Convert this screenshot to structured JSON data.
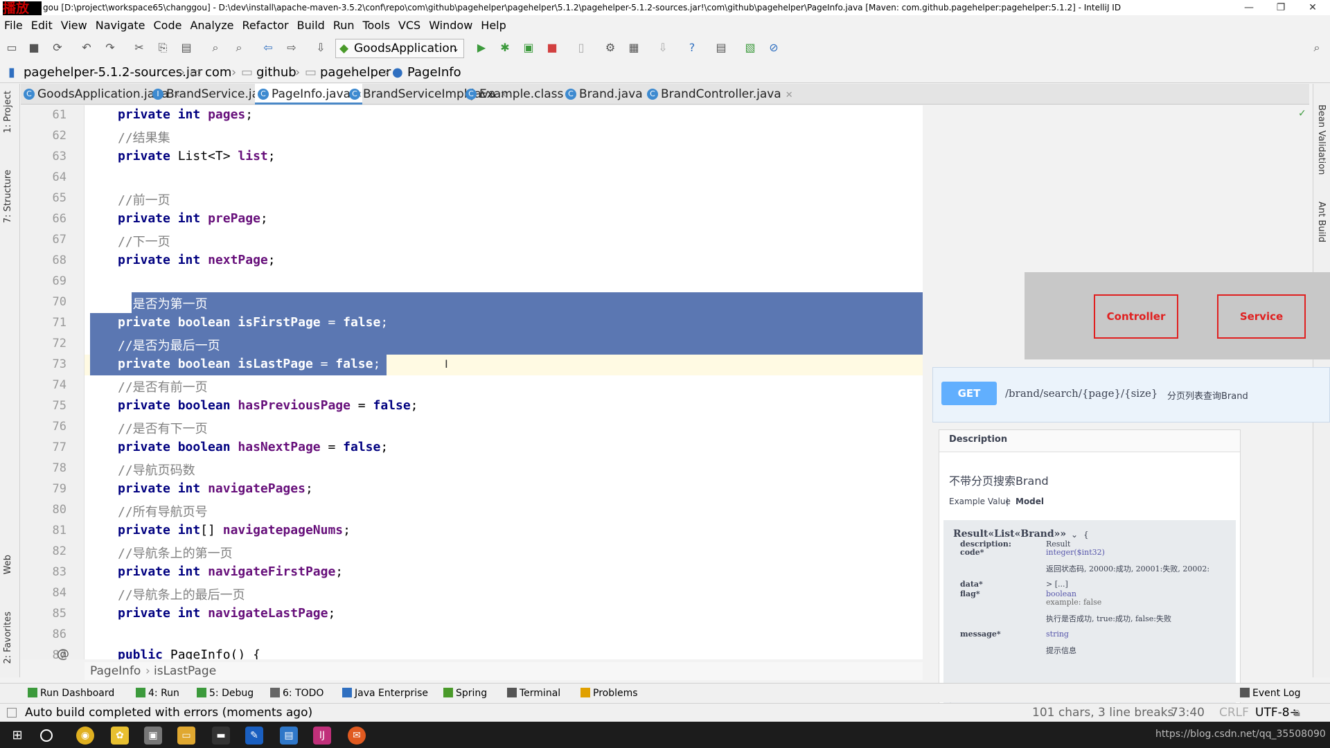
{
  "window": {
    "logo_text": "播放",
    "title": "gou [D:\\project\\workspace65\\changgou] - D:\\dev\\install\\apache-maven-3.5.2\\conf\\repo\\com\\github\\pagehelper\\pagehelper\\5.1.2\\pagehelper-5.1.2-sources.jar!\\com\\github\\pagehelper\\PageInfo.java [Maven: com.github.pagehelper:pagehelper:5.1.2] - IntelliJ ID",
    "minimize": "—",
    "maximize": "❐",
    "close": "✕"
  },
  "menu": [
    "File",
    "Edit",
    "View",
    "Navigate",
    "Code",
    "Analyze",
    "Refactor",
    "Build",
    "Run",
    "Tools",
    "VCS",
    "Window",
    "Help"
  ],
  "toolbar": {
    "run_config": "GoodsApplication"
  },
  "breadcrumb": [
    "pagehelper-5.1.2-sources.jar",
    "com",
    "github",
    "pagehelper",
    "PageInfo"
  ],
  "tabs": [
    {
      "label": "GoodsApplication.java",
      "icon": "C",
      "active": false
    },
    {
      "label": "BrandService.java",
      "icon": "I",
      "active": false
    },
    {
      "label": "PageInfo.java",
      "icon": "C",
      "active": true
    },
    {
      "label": "BrandServiceImpl.java",
      "icon": "C",
      "active": false
    },
    {
      "label": "Example.class",
      "icon": "C",
      "active": false
    },
    {
      "label": "Brand.java",
      "icon": "C",
      "active": false
    },
    {
      "label": "BrandController.java",
      "icon": "C",
      "active": false
    }
  ],
  "side_left": [
    "1: Project",
    "7: Structure",
    "Web",
    "2: Favorites"
  ],
  "side_right": [
    "Bean Validation",
    "Ant Build"
  ],
  "code_lines": [
    {
      "n": "61",
      "parts": [
        [
          "kw",
          "private "
        ],
        [
          "kw",
          "int "
        ],
        [
          "fld",
          "pages"
        ],
        [
          "",
          "; "
        ]
      ]
    },
    {
      "n": "62",
      "parts": [
        [
          "cmt",
          "//结果集"
        ]
      ]
    },
    {
      "n": "63",
      "parts": [
        [
          "kw",
          "private "
        ],
        [
          "",
          "List<T> "
        ],
        [
          "fld",
          "list"
        ],
        [
          "",
          ";"
        ]
      ]
    },
    {
      "n": "64",
      "parts": []
    },
    {
      "n": "65",
      "parts": [
        [
          "cmt",
          "//前一页"
        ]
      ]
    },
    {
      "n": "66",
      "parts": [
        [
          "kw",
          "private "
        ],
        [
          "kw",
          "int "
        ],
        [
          "fld",
          "prePage"
        ],
        [
          "",
          ";"
        ]
      ]
    },
    {
      "n": "67",
      "parts": [
        [
          "cmt",
          "//下一页"
        ]
      ]
    },
    {
      "n": "68",
      "parts": [
        [
          "kw",
          "private "
        ],
        [
          "kw",
          "int "
        ],
        [
          "fld",
          "nextPage"
        ],
        [
          "",
          ";"
        ]
      ]
    },
    {
      "n": "69",
      "parts": []
    },
    {
      "n": "70",
      "parts": [
        [
          "cmt",
          "//是否为第一页"
        ]
      ]
    },
    {
      "n": "71",
      "parts": [
        [
          "kw",
          "private "
        ],
        [
          "kw",
          "boolean "
        ],
        [
          "fld",
          "isFirstPage"
        ],
        [
          "",
          " = "
        ],
        [
          "kw",
          "false"
        ],
        [
          "",
          ";"
        ]
      ]
    },
    {
      "n": "72",
      "parts": [
        [
          "cmt",
          "//是否为最后一页"
        ]
      ]
    },
    {
      "n": "73",
      "parts": [
        [
          "kw",
          "private "
        ],
        [
          "kw",
          "boolean "
        ],
        [
          "fld",
          "isLastPage"
        ],
        [
          "",
          " = "
        ],
        [
          "kw",
          "false"
        ],
        [
          "",
          ";"
        ]
      ]
    },
    {
      "n": "74",
      "parts": [
        [
          "cmt",
          "//是否有前一页"
        ]
      ]
    },
    {
      "n": "75",
      "parts": [
        [
          "kw",
          "private "
        ],
        [
          "kw",
          "boolean "
        ],
        [
          "fld",
          "hasPreviousPage"
        ],
        [
          "",
          " = "
        ],
        [
          "kw",
          "false"
        ],
        [
          "",
          ";"
        ]
      ]
    },
    {
      "n": "76",
      "parts": [
        [
          "cmt",
          "//是否有下一页"
        ]
      ]
    },
    {
      "n": "77",
      "parts": [
        [
          "kw",
          "private "
        ],
        [
          "kw",
          "boolean "
        ],
        [
          "fld",
          "hasNextPage"
        ],
        [
          "",
          " = "
        ],
        [
          "kw",
          "false"
        ],
        [
          "",
          ";"
        ]
      ]
    },
    {
      "n": "78",
      "parts": [
        [
          "cmt",
          "//导航页码数"
        ]
      ]
    },
    {
      "n": "79",
      "parts": [
        [
          "kw",
          "private "
        ],
        [
          "kw",
          "int "
        ],
        [
          "fld",
          "navigatePages"
        ],
        [
          "",
          ";"
        ]
      ]
    },
    {
      "n": "80",
      "parts": [
        [
          "cmt",
          "//所有导航页号"
        ]
      ]
    },
    {
      "n": "81",
      "parts": [
        [
          "kw",
          "private "
        ],
        [
          "kw",
          "int"
        ],
        [
          "",
          "[] "
        ],
        [
          "fld",
          "navigatepageNums"
        ],
        [
          "",
          ";"
        ]
      ]
    },
    {
      "n": "82",
      "parts": [
        [
          "cmt",
          "//导航条上的第一页"
        ]
      ]
    },
    {
      "n": "83",
      "parts": [
        [
          "kw",
          "private "
        ],
        [
          "kw",
          "int "
        ],
        [
          "fld",
          "navigateFirstPage"
        ],
        [
          "",
          ";"
        ]
      ]
    },
    {
      "n": "84",
      "parts": [
        [
          "cmt",
          "//导航条上的最后一页"
        ]
      ]
    },
    {
      "n": "85",
      "parts": [
        [
          "kw",
          "private "
        ],
        [
          "kw",
          "int "
        ],
        [
          "fld",
          "navigateLastPage"
        ],
        [
          "",
          ";"
        ]
      ]
    },
    {
      "n": "86",
      "parts": []
    },
    {
      "n": "87",
      "parts": [
        [
          "kw",
          "public "
        ],
        [
          "",
          "PageInfo() {"
        ]
      ]
    }
  ],
  "overlay": {
    "controller": "Controller",
    "service": "Service"
  },
  "swagger": {
    "method": "GET",
    "path": "/brand/search/{page}/{size}",
    "summary": "分页列表查询Brand",
    "desc_header": "Description",
    "desc_text": "不带分页搜索Brand",
    "example_value": "Example Value",
    "model_tab": "Model",
    "model_title": "Result«List«Brand»»",
    "brace_open": "{",
    "brace_close": "}",
    "rows": [
      {
        "k": "description:",
        "v": "Result"
      },
      {
        "k": "code*",
        "v": "integer($int32)"
      },
      {
        "k": "",
        "v": "返回状态码, 20000:成功, 20001:失败, 20002:"
      },
      {
        "k": "data*",
        "v": "> [...]"
      },
      {
        "k": "flag*",
        "v": "boolean"
      },
      {
        "k": "",
        "v": "example: false"
      },
      {
        "k": "",
        "v": "执行是否成功, true:成功, false:失败"
      },
      {
        "k": "message*",
        "v": "string"
      },
      {
        "k": "",
        "v": "提示信息"
      }
    ]
  },
  "nav_crumb": [
    "PageInfo",
    "isLastPage"
  ],
  "toolwindows": [
    "Run Dashboard",
    "4: Run",
    "5: Debug",
    "6: TODO",
    "Java Enterprise",
    "Spring",
    "Terminal",
    "Problems",
    "Event Log"
  ],
  "status": {
    "message": "Auto build completed with errors (moments ago)",
    "selection": "101 chars, 3 line breaks",
    "position": "73:40",
    "line_sep": "CRLF",
    "encoding": "UTF-8÷"
  },
  "taskbar": {
    "watermark": "https://blog.csdn.net/qq_35508090"
  }
}
